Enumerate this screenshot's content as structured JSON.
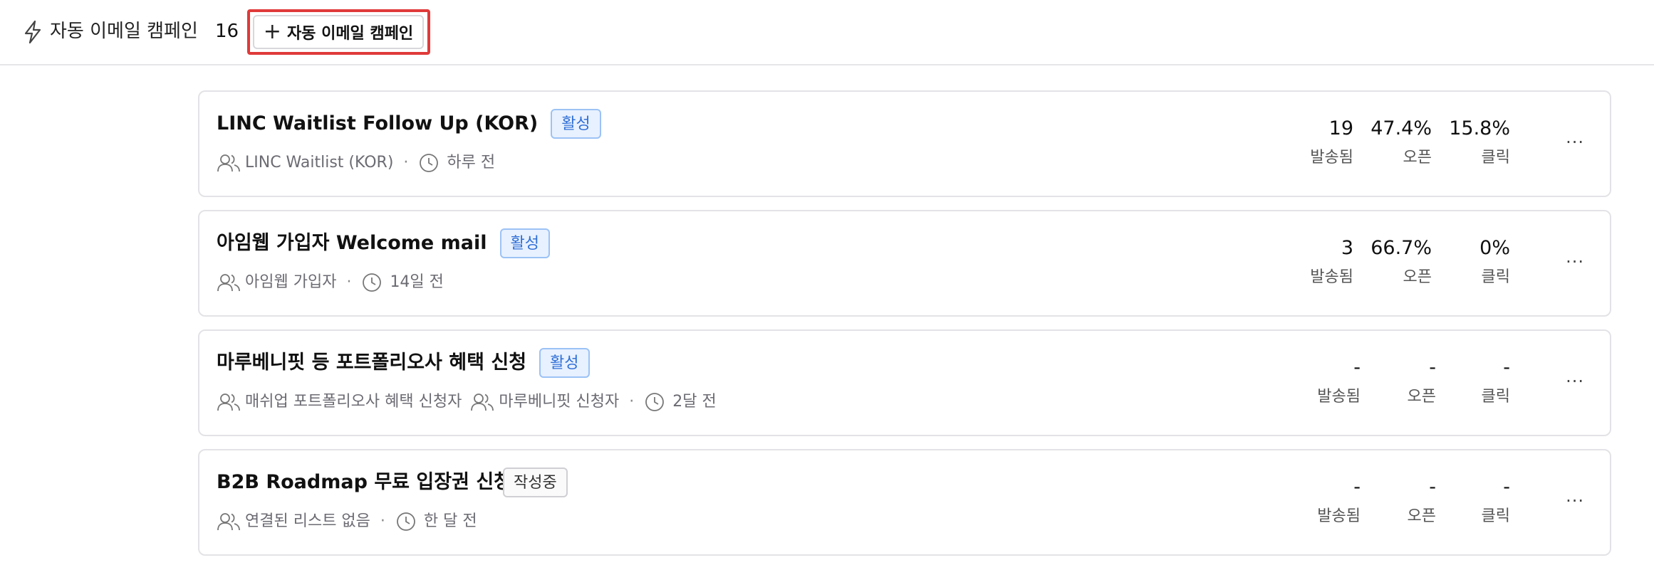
{
  "header": {
    "title": "자동 이메일 캠페인",
    "count": "16",
    "create_button_label": "자동 이메일 캠페인",
    "plus_glyph": "+",
    "highlight_color": "#e03a3a"
  },
  "stat_labels": {
    "sent": "발송됨",
    "open": "오픈",
    "click": "클릭"
  },
  "more_glyph": "···",
  "campaigns": [
    {
      "title": "LINC Waitlist Follow Up (KOR)",
      "status": "활성",
      "lists": [
        "LINC Waitlist (KOR)"
      ],
      "time": "하루 전",
      "sent": "19",
      "open": "47.4%",
      "click": "15.8%"
    },
    {
      "title": "아임웹 가입자 Welcome mail",
      "status": "활성",
      "lists": [
        "아임웹 가입자"
      ],
      "time": "14일 전",
      "sent": "3",
      "open": "66.7%",
      "click": "0%"
    },
    {
      "title": "마루베니핏 등 포트폴리오사 혜택 신청",
      "status": "활성",
      "lists": [
        "매쉬업 포트폴리오사 혜택 신청자",
        "마루베니핏 신청자"
      ],
      "time": "2달 전",
      "sent": "-",
      "open": "-",
      "click": "-"
    },
    {
      "title": "B2B Roadmap 무료 입장권 신청...",
      "status": "작성중",
      "lists": [
        "연결된 리스트 없음"
      ],
      "time": "한 달 전",
      "sent": "-",
      "open": "-",
      "click": "-"
    }
  ],
  "colors": {
    "active_badge_bg": "#e8f1ff",
    "active_badge_text": "#2f6fd6",
    "draft_badge_border": "#cfcfd4"
  }
}
